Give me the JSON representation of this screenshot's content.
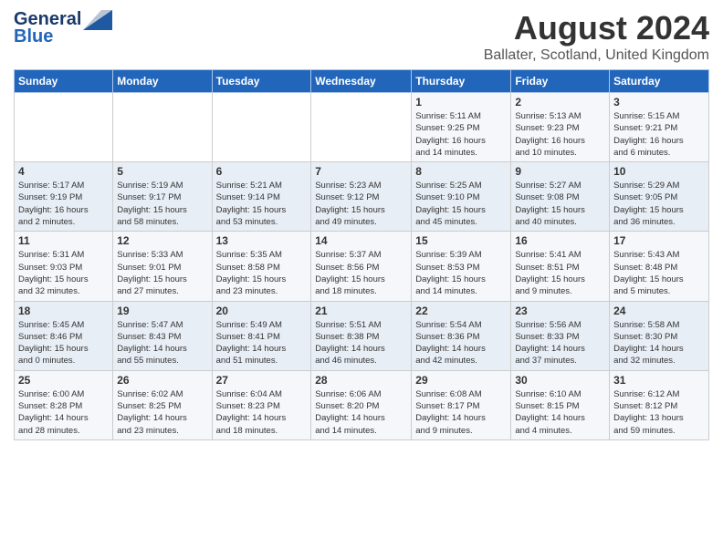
{
  "header": {
    "logo_line1": "General",
    "logo_line2": "Blue",
    "title": "August 2024",
    "subtitle": "Ballater, Scotland, United Kingdom"
  },
  "calendar": {
    "weekdays": [
      "Sunday",
      "Monday",
      "Tuesday",
      "Wednesday",
      "Thursday",
      "Friday",
      "Saturday"
    ],
    "weeks": [
      [
        {
          "day": "",
          "info": ""
        },
        {
          "day": "",
          "info": ""
        },
        {
          "day": "",
          "info": ""
        },
        {
          "day": "",
          "info": ""
        },
        {
          "day": "1",
          "info": "Sunrise: 5:11 AM\nSunset: 9:25 PM\nDaylight: 16 hours\nand 14 minutes."
        },
        {
          "day": "2",
          "info": "Sunrise: 5:13 AM\nSunset: 9:23 PM\nDaylight: 16 hours\nand 10 minutes."
        },
        {
          "day": "3",
          "info": "Sunrise: 5:15 AM\nSunset: 9:21 PM\nDaylight: 16 hours\nand 6 minutes."
        }
      ],
      [
        {
          "day": "4",
          "info": "Sunrise: 5:17 AM\nSunset: 9:19 PM\nDaylight: 16 hours\nand 2 minutes."
        },
        {
          "day": "5",
          "info": "Sunrise: 5:19 AM\nSunset: 9:17 PM\nDaylight: 15 hours\nand 58 minutes."
        },
        {
          "day": "6",
          "info": "Sunrise: 5:21 AM\nSunset: 9:14 PM\nDaylight: 15 hours\nand 53 minutes."
        },
        {
          "day": "7",
          "info": "Sunrise: 5:23 AM\nSunset: 9:12 PM\nDaylight: 15 hours\nand 49 minutes."
        },
        {
          "day": "8",
          "info": "Sunrise: 5:25 AM\nSunset: 9:10 PM\nDaylight: 15 hours\nand 45 minutes."
        },
        {
          "day": "9",
          "info": "Sunrise: 5:27 AM\nSunset: 9:08 PM\nDaylight: 15 hours\nand 40 minutes."
        },
        {
          "day": "10",
          "info": "Sunrise: 5:29 AM\nSunset: 9:05 PM\nDaylight: 15 hours\nand 36 minutes."
        }
      ],
      [
        {
          "day": "11",
          "info": "Sunrise: 5:31 AM\nSunset: 9:03 PM\nDaylight: 15 hours\nand 32 minutes."
        },
        {
          "day": "12",
          "info": "Sunrise: 5:33 AM\nSunset: 9:01 PM\nDaylight: 15 hours\nand 27 minutes."
        },
        {
          "day": "13",
          "info": "Sunrise: 5:35 AM\nSunset: 8:58 PM\nDaylight: 15 hours\nand 23 minutes."
        },
        {
          "day": "14",
          "info": "Sunrise: 5:37 AM\nSunset: 8:56 PM\nDaylight: 15 hours\nand 18 minutes."
        },
        {
          "day": "15",
          "info": "Sunrise: 5:39 AM\nSunset: 8:53 PM\nDaylight: 15 hours\nand 14 minutes."
        },
        {
          "day": "16",
          "info": "Sunrise: 5:41 AM\nSunset: 8:51 PM\nDaylight: 15 hours\nand 9 minutes."
        },
        {
          "day": "17",
          "info": "Sunrise: 5:43 AM\nSunset: 8:48 PM\nDaylight: 15 hours\nand 5 minutes."
        }
      ],
      [
        {
          "day": "18",
          "info": "Sunrise: 5:45 AM\nSunset: 8:46 PM\nDaylight: 15 hours\nand 0 minutes."
        },
        {
          "day": "19",
          "info": "Sunrise: 5:47 AM\nSunset: 8:43 PM\nDaylight: 14 hours\nand 55 minutes."
        },
        {
          "day": "20",
          "info": "Sunrise: 5:49 AM\nSunset: 8:41 PM\nDaylight: 14 hours\nand 51 minutes."
        },
        {
          "day": "21",
          "info": "Sunrise: 5:51 AM\nSunset: 8:38 PM\nDaylight: 14 hours\nand 46 minutes."
        },
        {
          "day": "22",
          "info": "Sunrise: 5:54 AM\nSunset: 8:36 PM\nDaylight: 14 hours\nand 42 minutes."
        },
        {
          "day": "23",
          "info": "Sunrise: 5:56 AM\nSunset: 8:33 PM\nDaylight: 14 hours\nand 37 minutes."
        },
        {
          "day": "24",
          "info": "Sunrise: 5:58 AM\nSunset: 8:30 PM\nDaylight: 14 hours\nand 32 minutes."
        }
      ],
      [
        {
          "day": "25",
          "info": "Sunrise: 6:00 AM\nSunset: 8:28 PM\nDaylight: 14 hours\nand 28 minutes."
        },
        {
          "day": "26",
          "info": "Sunrise: 6:02 AM\nSunset: 8:25 PM\nDaylight: 14 hours\nand 23 minutes."
        },
        {
          "day": "27",
          "info": "Sunrise: 6:04 AM\nSunset: 8:23 PM\nDaylight: 14 hours\nand 18 minutes."
        },
        {
          "day": "28",
          "info": "Sunrise: 6:06 AM\nSunset: 8:20 PM\nDaylight: 14 hours\nand 14 minutes."
        },
        {
          "day": "29",
          "info": "Sunrise: 6:08 AM\nSunset: 8:17 PM\nDaylight: 14 hours\nand 9 minutes."
        },
        {
          "day": "30",
          "info": "Sunrise: 6:10 AM\nSunset: 8:15 PM\nDaylight: 14 hours\nand 4 minutes."
        },
        {
          "day": "31",
          "info": "Sunrise: 6:12 AM\nSunset: 8:12 PM\nDaylight: 13 hours\nand 59 minutes."
        }
      ]
    ]
  }
}
